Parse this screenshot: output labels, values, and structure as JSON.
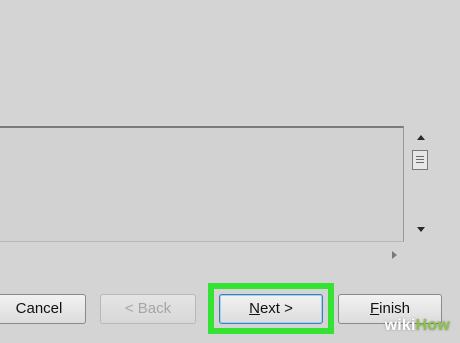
{
  "buttons": {
    "cancel": "Cancel",
    "back": "< Back",
    "next_key": "N",
    "next_rest": "ext >",
    "finish_key": "F",
    "finish_rest": "inish"
  },
  "watermark": {
    "part1": "wiki",
    "part2": "How"
  },
  "colors": {
    "highlight": "#33e233",
    "background": "#d4d4d4"
  }
}
